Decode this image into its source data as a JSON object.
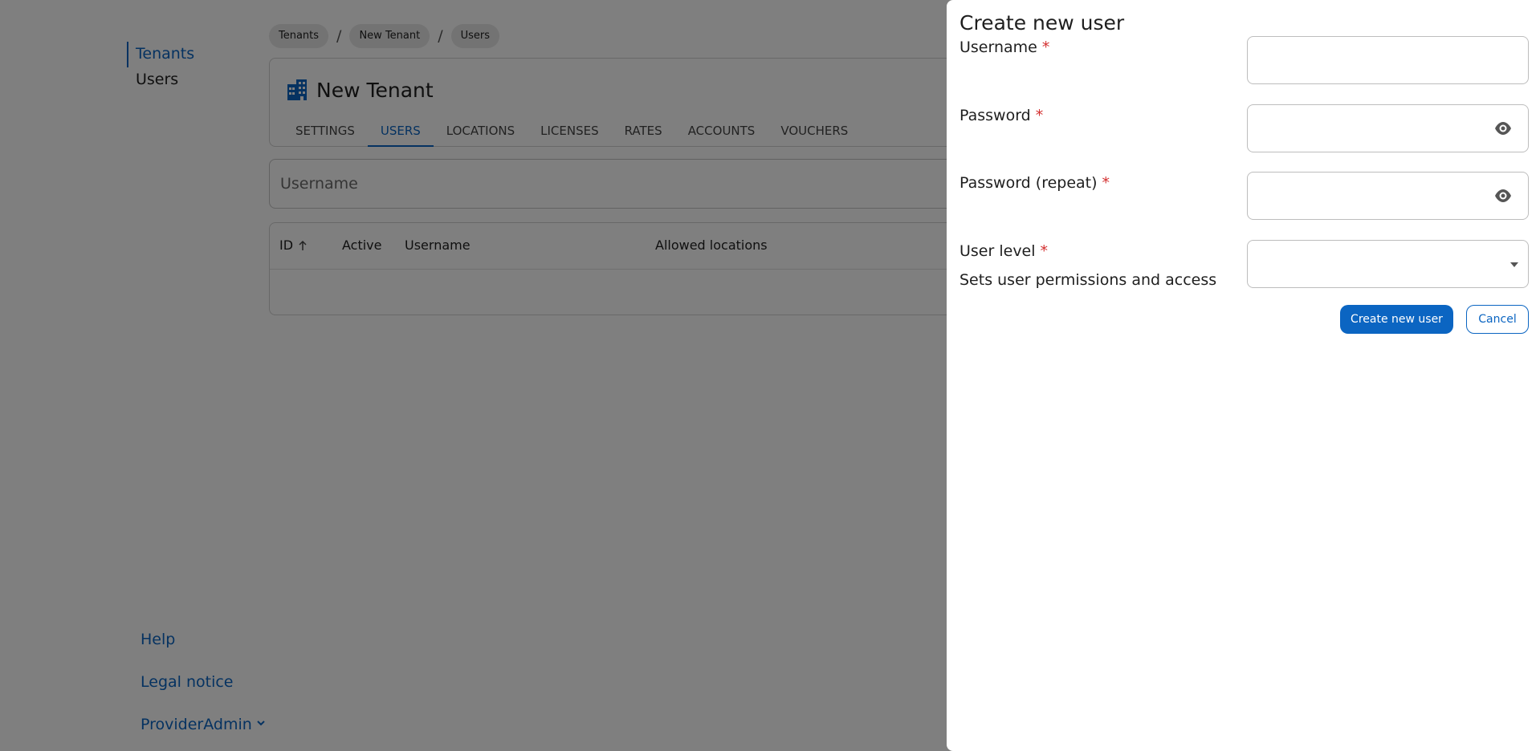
{
  "sidebar": {
    "items": [
      {
        "label": "Tenants",
        "active": true
      },
      {
        "label": "Users",
        "active": false
      }
    ],
    "bottom": {
      "help": "Help",
      "legal": "Legal notice",
      "user_menu": "ProviderAdmin",
      "user_menu_icon": "chevron-down-icon"
    }
  },
  "breadcrumb": {
    "items": [
      "Tenants",
      "New Tenant",
      "Users"
    ],
    "separator": "/"
  },
  "tenant": {
    "icon": "building-icon",
    "name": "New Tenant",
    "tabs": [
      {
        "label": "SETTINGS",
        "active": false
      },
      {
        "label": "USERS",
        "active": true
      },
      {
        "label": "LOCATIONS",
        "active": false
      },
      {
        "label": "LICENSES",
        "active": false
      },
      {
        "label": "RATES",
        "active": false
      },
      {
        "label": "ACCOUNTS",
        "active": false
      },
      {
        "label": "VOUCHERS",
        "active": false
      }
    ]
  },
  "search": {
    "placeholder": "Username"
  },
  "table": {
    "columns": [
      "ID",
      "Active",
      "Username",
      "Allowed locations"
    ],
    "sort_icon": "arrow-up-icon"
  },
  "dialog": {
    "title": "Create new user",
    "fields": {
      "username": {
        "label": "Username",
        "required_mark": "*",
        "value": ""
      },
      "password": {
        "label": "Password",
        "required_mark": "*",
        "value": "",
        "icon": "eye-icon"
      },
      "password_repeat": {
        "label": "Password (repeat)",
        "required_mark": "*",
        "value": "",
        "icon": "eye-icon"
      },
      "user_level": {
        "label": "User level",
        "required_mark": "*",
        "helper": "Sets user permissions and access",
        "value": "",
        "icon": "caret-down-icon"
      }
    },
    "buttons": {
      "create": "Create new user",
      "cancel": "Cancel"
    }
  },
  "colors": {
    "accent": "#0b65c2",
    "required": "#d32f2f",
    "overlay": "rgba(0,0,0,0.5)"
  }
}
